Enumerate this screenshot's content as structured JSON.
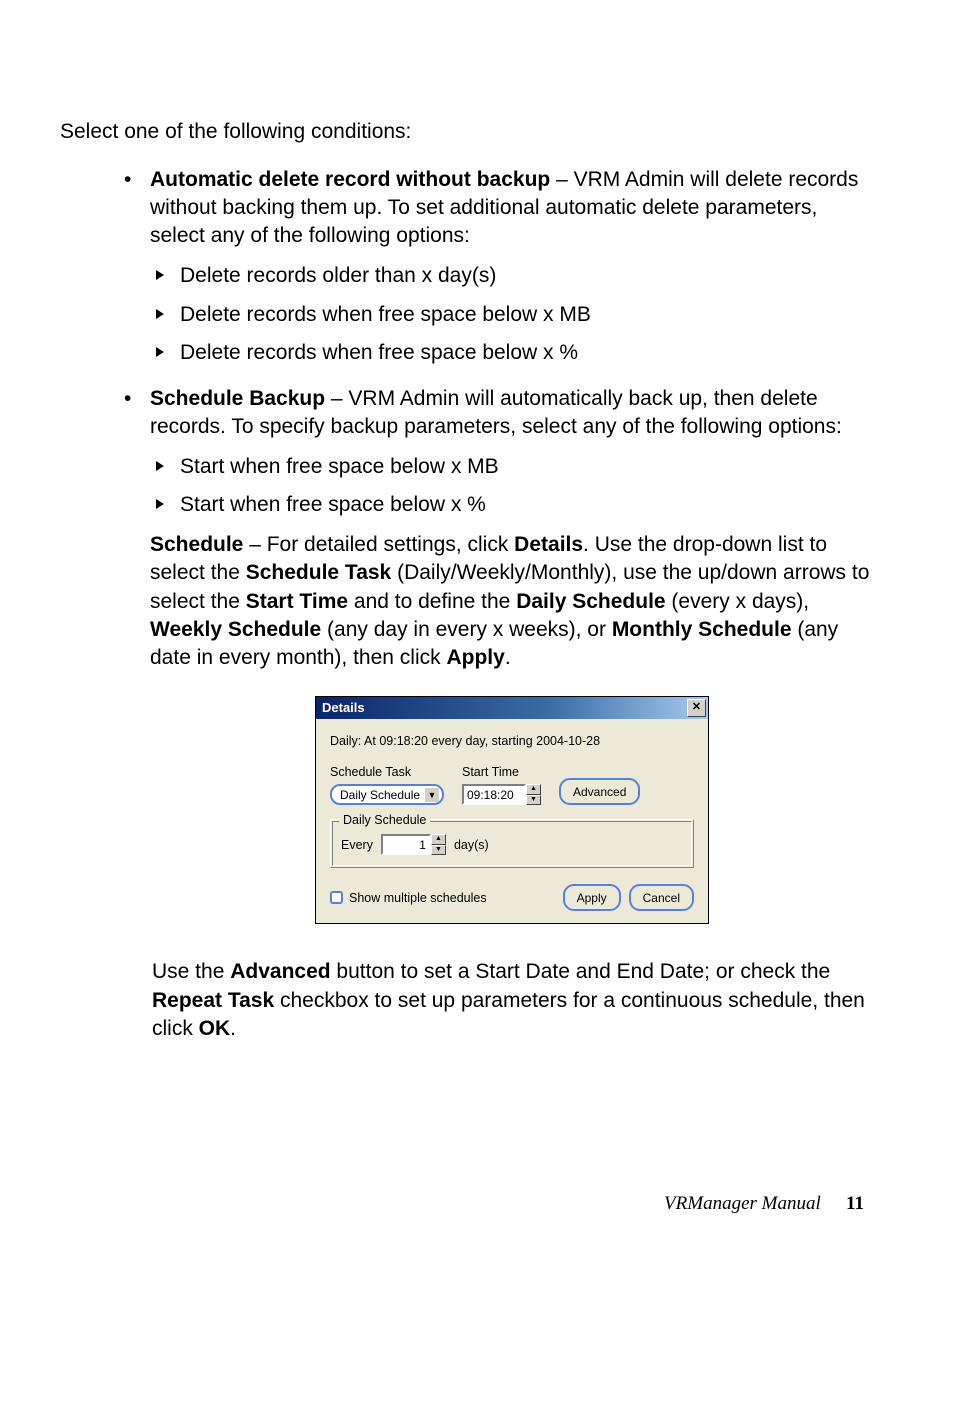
{
  "intro": "Select one of the following conditions:",
  "item1": {
    "title": "Automatic delete record without backup",
    "desc": " – VRM Admin will delete records without backing them up. To set additional automatic delete parameters, select any of the following options:",
    "subs": [
      "Delete records older than x day(s)",
      "Delete records when free space below x MB",
      "Delete records when free space below x %"
    ]
  },
  "item2": {
    "title": "Schedule Backup",
    "desc": " – VRM Admin will automatically back up, then delete records. To specify backup parameters, select any of the following options:",
    "subs": [
      "Start when free space below x MB",
      "Start when free space below x %"
    ],
    "schedule": {
      "lead1": "Schedule",
      "t1": " – For detailed settings, click ",
      "b1": "Details",
      "t2": ". Use the drop-down list to select the ",
      "b2": "Schedule Task",
      "t3": " (Daily/Weekly/Monthly), use the up/down arrows to select the ",
      "b3": "Start Time",
      "t4": " and to define the ",
      "b4": "Daily Schedule",
      "t5": " (every x days), ",
      "b5": "Weekly Schedule",
      "t6": " (any day in every x weeks), or ",
      "b6": "Monthly Schedule",
      "t7": " (any date in every month), then click ",
      "b7": "Apply",
      "t8": "."
    }
  },
  "chart_data": {
    "type": "table",
    "title": "Details",
    "values": {
      "schedule_summary": "Daily: At 09:18:20 every day, starting 2004-10-28",
      "schedule_task": "Daily Schedule",
      "start_time": "09:18:20",
      "daily_every": 1,
      "daily_unit": "day(s)",
      "show_multiple_schedules": false
    }
  },
  "dialog": {
    "title": "Details",
    "close_glyph": "✕",
    "summary": "Daily: At 09:18:20 every day, starting 2004-10-28",
    "schedule_task_label": "Schedule Task",
    "start_time_label": "Start Time",
    "schedule_task_value": "Daily Schedule",
    "start_time_value": "09:18:20",
    "advanced_btn": "Advanced",
    "group_title": "Daily Schedule",
    "every_label": "Every",
    "every_value": "1",
    "days_label": "day(s)",
    "show_multiple": "Show multiple schedules",
    "apply": "Apply",
    "cancel": "Cancel",
    "dd_glyph": "▼",
    "up_glyph": "▲",
    "down_glyph": "▼"
  },
  "after": {
    "t1": "Use the ",
    "b1": "Advanced",
    "t2": " button to set a Start Date and End Date; or check the ",
    "b2": "Repeat Task",
    "t3": " checkbox to set up parameters for a continuous schedule, then click ",
    "b3": "OK",
    "t4": "."
  },
  "footer": {
    "book": "VRManager Manual",
    "page": "11"
  }
}
